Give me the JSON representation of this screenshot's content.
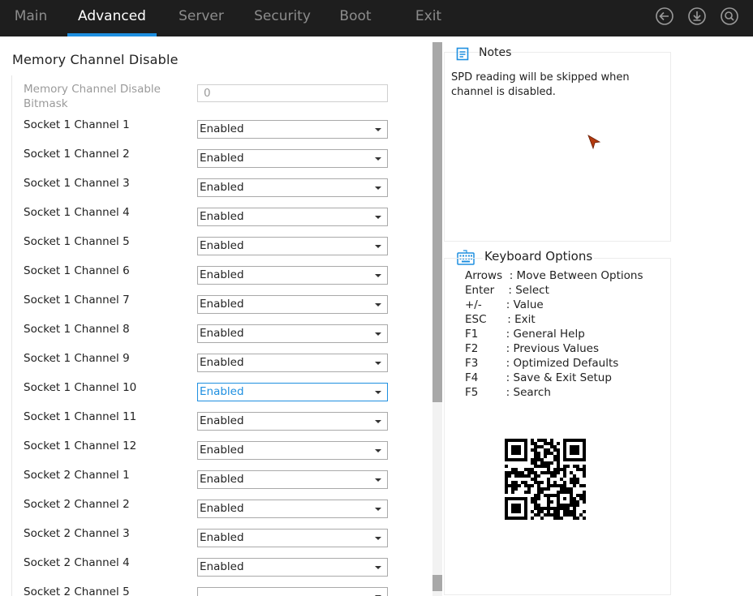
{
  "tabs": [
    {
      "label": "Main",
      "active": false
    },
    {
      "label": "Advanced",
      "active": true
    },
    {
      "label": "Server",
      "active": false
    },
    {
      "label": "Security",
      "active": false
    },
    {
      "label": "Boot",
      "active": false
    },
    {
      "label": "Exit",
      "active": false
    }
  ],
  "top_icons": [
    "back-arrow-icon",
    "download-icon",
    "search-icon"
  ],
  "accent_color": "#1e8fe0",
  "page_title": "Memory Channel Disable",
  "bitmask": {
    "label": "Memory Channel Disable Bitmask",
    "value": "0"
  },
  "settings": [
    {
      "label": "Socket 1 Channel 1",
      "value": "Enabled"
    },
    {
      "label": "Socket 1 Channel 2",
      "value": "Enabled"
    },
    {
      "label": "Socket 1 Channel 3",
      "value": "Enabled"
    },
    {
      "label": "Socket 1 Channel 4",
      "value": "Enabled"
    },
    {
      "label": "Socket 1 Channel 5",
      "value": "Enabled"
    },
    {
      "label": "Socket 1 Channel 6",
      "value": "Enabled"
    },
    {
      "label": "Socket 1 Channel 7",
      "value": "Enabled"
    },
    {
      "label": "Socket 1 Channel 8",
      "value": "Enabled"
    },
    {
      "label": "Socket 1 Channel 9",
      "value": "Enabled"
    },
    {
      "label": "Socket 1 Channel 10",
      "value": "Enabled"
    },
    {
      "label": "Socket 1 Channel 11",
      "value": "Enabled"
    },
    {
      "label": "Socket 1 Channel 12",
      "value": "Enabled"
    },
    {
      "label": "Socket 2 Channel 1",
      "value": "Enabled"
    },
    {
      "label": "Socket 2 Channel 2",
      "value": "Enabled"
    },
    {
      "label": "Socket 2 Channel 3",
      "value": "Enabled"
    },
    {
      "label": "Socket 2 Channel 4",
      "value": "Enabled"
    },
    {
      "label": "Socket 2 Channel 5",
      "value": ""
    }
  ],
  "focused_setting": "Socket 1 Channel 10",
  "notes": {
    "title": "Notes",
    "text": "SPD reading will be skipped when channel is disabled."
  },
  "keyboard": {
    "title": "Keyboard Options",
    "lines": [
      "Arrows  : Move Between Options",
      "Enter    : Select",
      "+/-       : Value",
      "ESC      : Exit",
      "F1        : General Help",
      "F2        : Previous Values",
      "F3        : Optimized Defaults",
      "F4        : Save & Exit Setup",
      "F5        : Search"
    ]
  }
}
